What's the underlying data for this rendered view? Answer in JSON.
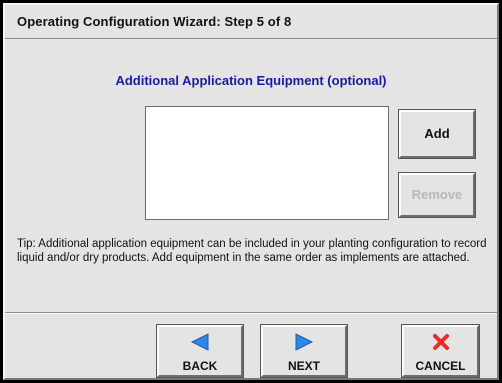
{
  "window": {
    "title": "Operating Configuration Wizard:  Step 5 of 8"
  },
  "main": {
    "heading": "Additional Application Equipment (optional)",
    "equipment_list": [],
    "add_label": "Add",
    "remove_label": "Remove",
    "remove_enabled": false,
    "tip": "Tip:  Additional application equipment can be included in your planting configuration to record liquid and/or dry products.  Add equipment in the same order as implements are attached."
  },
  "nav": {
    "back_label": "BACK",
    "next_label": "NEXT",
    "cancel_label": "CANCEL",
    "arrow_color": "#2f86e4",
    "cancel_icon_color": "#ee2a2a"
  },
  "icons": {
    "back": "arrow-left-icon",
    "next": "arrow-right-icon",
    "cancel": "close-x-icon"
  }
}
